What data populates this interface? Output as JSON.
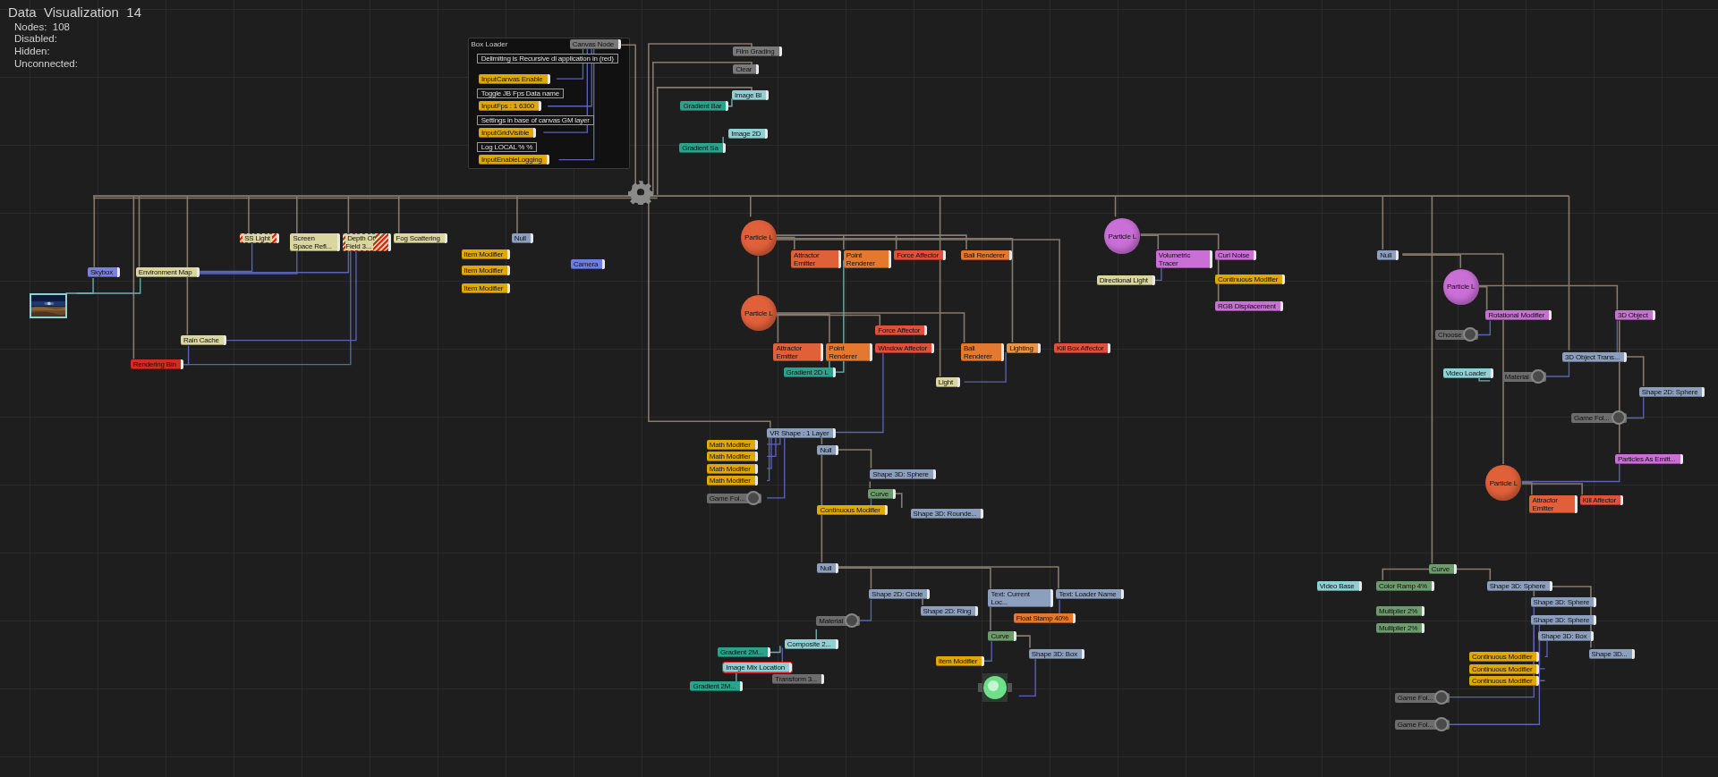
{
  "header": {
    "title": "Data  Visualization  14",
    "stats": [
      "Nodes:  108",
      "Disabled:",
      "Hidden:",
      "Unconnected:"
    ]
  },
  "group": {
    "title": "Box Loader"
  },
  "nodes": [
    {
      "kind": "bar",
      "label": "Canvas Node",
      "color": "#7a7a7a"
    },
    {
      "kind": "comment",
      "label": "Delimiting is Recursive dl application in (red)"
    },
    {
      "kind": "bar",
      "label": "InputCanvas Enable",
      "color": "#e0a800"
    },
    {
      "kind": "comment",
      "label": "Toggle JB Fps Data name"
    },
    {
      "kind": "bar",
      "label": "InputFps : 1 6300",
      "color": "#e0a800"
    },
    {
      "kind": "comment",
      "label": "Settings in base of canvas GM layer"
    },
    {
      "kind": "bar",
      "label": "InputGridVisible",
      "color": "#e0a800"
    },
    {
      "kind": "comment",
      "label": "Log LOCAL % %"
    },
    {
      "kind": "bar",
      "label": "InputEnableLogging",
      "color": "#e0a800"
    },
    {
      "kind": "bar",
      "label": "Film Grading",
      "color": "#7a7a7a"
    },
    {
      "kind": "bar",
      "label": "Clear",
      "color": "#7a7a7a"
    },
    {
      "kind": "bar",
      "label": "Gradient Bar",
      "color": "#2aa38a"
    },
    {
      "kind": "bar",
      "label": "Image Bl",
      "color": "#8fd0d4"
    },
    {
      "kind": "bar",
      "label": "Gradient Sa",
      "color": "#2aa38a"
    },
    {
      "kind": "bar",
      "label": "Image 2D",
      "color": "#8fd0d4"
    },
    {
      "kind": "picture",
      "color": "#8fd0d4"
    },
    {
      "kind": "bar",
      "label": "Skybox",
      "color": "#7b7fe0"
    },
    {
      "kind": "bar",
      "label": "Environment Map",
      "color": "#d9d6a0"
    },
    {
      "kind": "hatched",
      "label": "SS Light",
      "color": "#d9d6a0"
    },
    {
      "kind": "bar",
      "label": "Screen Space Refl...",
      "color": "#d9d6a0"
    },
    {
      "kind": "hatched",
      "label": "Depth Of Field 3...",
      "color": "#d9d6a0"
    },
    {
      "kind": "bar",
      "label": "Fog Scattering",
      "color": "#d9d6a0"
    },
    {
      "kind": "bar",
      "label": "Rain Cache",
      "color": "#d9d6a0"
    },
    {
      "kind": "bar",
      "label": "Rendering Bin",
      "color": "#d62b1f"
    },
    {
      "kind": "bar",
      "label": "Item Modifier",
      "color": "#e0a800"
    },
    {
      "kind": "bar",
      "label": "Item Modifier",
      "color": "#e0a800"
    },
    {
      "kind": "bar",
      "label": "Item Modifier",
      "color": "#e0a800"
    },
    {
      "kind": "bar",
      "label": "Null",
      "color": "#8c9fbe"
    },
    {
      "kind": "bar",
      "label": "Camera",
      "color": "#6c7fe0"
    },
    {
      "kind": "sphere",
      "label": "Particle L",
      "color": "#e0603a"
    },
    {
      "kind": "sphere",
      "label": "Particle L",
      "color": "#e0603a"
    },
    {
      "kind": "bar",
      "label": "Attractor Emitter",
      "color": "#e0603a"
    },
    {
      "kind": "bar",
      "label": "Point Renderer",
      "color": "#e4782e"
    },
    {
      "kind": "bar",
      "label": "Force Affector",
      "color": "#e0503a"
    },
    {
      "kind": "bar",
      "label": "Ball Renderer",
      "color": "#e4782e"
    },
    {
      "kind": "bar",
      "label": "Attractor Emitter",
      "color": "#e0603a"
    },
    {
      "kind": "bar",
      "label": "Point Renderer",
      "color": "#e4782e"
    },
    {
      "kind": "bar",
      "label": "Force Affector",
      "color": "#e0503a"
    },
    {
      "kind": "bar",
      "label": "Window Affector",
      "color": "#e0503a"
    },
    {
      "kind": "bar",
      "label": "Ball Renderer",
      "color": "#e4782e"
    },
    {
      "kind": "bar",
      "label": "Lighting",
      "color": "#e8954a"
    },
    {
      "kind": "bar",
      "label": "Kill Box Affector",
      "color": "#e0503a"
    },
    {
      "kind": "bar",
      "label": "Gradient 2D L",
      "color": "#2aa38a"
    },
    {
      "kind": "bar",
      "label": "Light",
      "color": "#d9d6a0"
    },
    {
      "kind": "sphere",
      "label": "Particle L",
      "color": "#c96fd6"
    },
    {
      "kind": "bar",
      "label": "Volumetric Tracer",
      "color": "#c96fd6"
    },
    {
      "kind": "bar",
      "label": "Curl Noise",
      "color": "#c96fd6"
    },
    {
      "kind": "bar",
      "label": "Continuous Modifier",
      "color": "#e0a800"
    },
    {
      "kind": "bar",
      "label": "RGB Displacement",
      "color": "#c96fd6"
    },
    {
      "kind": "bar",
      "label": "Directional Light",
      "color": "#d9d6a0"
    },
    {
      "kind": "bar",
      "label": "Null",
      "color": "#8c9fbe"
    },
    {
      "kind": "sphere",
      "label": "Particle L",
      "color": "#c96fd6"
    },
    {
      "kind": "bar",
      "label": "Rotational Modifier",
      "color": "#c96fd6"
    },
    {
      "kind": "bar",
      "label": "3D Object",
      "color": "#c96fd6"
    },
    {
      "kind": "dial",
      "label": "Choose",
      "color": "#6c6c6c"
    },
    {
      "kind": "bar",
      "label": "3D Object Trans...",
      "color": "#8c9fbe"
    },
    {
      "kind": "bar",
      "label": "Video Loader",
      "color": "#8fd0d4"
    },
    {
      "kind": "dial",
      "label": "Material",
      "color": "#6c6c6c"
    },
    {
      "kind": "bar",
      "label": "Shape 2D: Sphere",
      "color": "#8c9fbe"
    },
    {
      "kind": "dial",
      "label": "Game Fol...",
      "color": "#6c6c6c"
    },
    {
      "kind": "bar",
      "label": "Particles As Emitt...",
      "color": "#c96fd6"
    },
    {
      "kind": "sphere",
      "label": "Particle L",
      "color": "#e0603a"
    },
    {
      "kind": "bar",
      "label": "Attractor Emitter",
      "color": "#e0603a"
    },
    {
      "kind": "bar",
      "label": "Kill Affector",
      "color": "#e0503a"
    },
    {
      "kind": "bar",
      "label": "VR Shape : 1 Layer",
      "color": "#8c9fbe"
    },
    {
      "kind": "bar",
      "label": "Math Modifier",
      "color": "#e0a800"
    },
    {
      "kind": "bar",
      "label": "Math Modifier",
      "color": "#e0a800"
    },
    {
      "kind": "bar",
      "label": "Math Modifier",
      "color": "#e0a800"
    },
    {
      "kind": "bar",
      "label": "Math Modifier",
      "color": "#e0a800"
    },
    {
      "kind": "dial",
      "label": "Game Fol...",
      "color": "#6c6c6c"
    },
    {
      "kind": "bar",
      "label": "Null",
      "color": "#8c9fbe"
    },
    {
      "kind": "bar",
      "label": "Shape 3D: Sphere",
      "color": "#8c9fbe"
    },
    {
      "kind": "bar",
      "label": "Curve",
      "color": "#6c9b6c"
    },
    {
      "kind": "bar",
      "label": "Continuous Modifier",
      "color": "#e0a800"
    },
    {
      "kind": "bar",
      "label": "Shape 3D: Rounde...",
      "color": "#8c9fbe"
    },
    {
      "kind": "bar",
      "label": "Null",
      "color": "#8c9fbe"
    },
    {
      "kind": "bar",
      "label": "Shape 2D: Circle",
      "color": "#8c9fbe"
    },
    {
      "kind": "bar",
      "label": "Shape 2D: Ring",
      "color": "#8c9fbe"
    },
    {
      "kind": "bar",
      "label": "Text: Current Loc...",
      "color": "#8c9fbe"
    },
    {
      "kind": "bar",
      "label": "Text: Loader Name",
      "color": "#8c9fbe"
    },
    {
      "kind": "bar",
      "label": "Float Stamp 40%",
      "color": "#e4782e"
    },
    {
      "kind": "bar",
      "label": "Curve",
      "color": "#6c9b6c"
    },
    {
      "kind": "bar",
      "label": "Shape 3D: Box",
      "color": "#8c9fbe"
    },
    {
      "kind": "bar",
      "label": "Item Modifier",
      "color": "#e0a800"
    },
    {
      "kind": "orb",
      "color": "#6ee08a"
    },
    {
      "kind": "dial",
      "label": "Material",
      "color": "#6c6c6c"
    },
    {
      "kind": "bar",
      "label": "Composite 2...",
      "color": "#8fd0d4"
    },
    {
      "kind": "bar",
      "label": "Gradient 2M...",
      "color": "#2aa38a"
    },
    {
      "kind": "outlined",
      "label": "Image Mix Location",
      "color": "#8fd0d4"
    },
    {
      "kind": "bar",
      "label": "Transform 3...",
      "color": "#6c6c6c"
    },
    {
      "kind": "bar",
      "label": "Gradient 2M...",
      "color": "#2aa38a"
    },
    {
      "kind": "bar",
      "label": "Curve",
      "color": "#6c9b6c"
    },
    {
      "kind": "bar",
      "label": "Video Base",
      "color": "#8fd0d4"
    },
    {
      "kind": "bar",
      "label": "Color Ramp 4%",
      "color": "#6c9b6c"
    },
    {
      "kind": "bar",
      "label": "Multiplier 2%",
      "color": "#6c9b6c"
    },
    {
      "kind": "bar",
      "label": "Multiplier 2%",
      "color": "#6c9b6c"
    },
    {
      "kind": "bar",
      "label": "Shape 3D: Sphere",
      "color": "#8c9fbe"
    },
    {
      "kind": "bar",
      "label": "Shape 3D: Sphere",
      "color": "#8c9fbe"
    },
    {
      "kind": "bar",
      "label": "Shape 3D: Sphere",
      "color": "#8c9fbe"
    },
    {
      "kind": "bar",
      "label": "Shape 3D: Box",
      "color": "#8c9fbe"
    },
    {
      "kind": "bar",
      "label": "Continuous Modifier",
      "color": "#e0a800"
    },
    {
      "kind": "bar",
      "label": "Shape 3D...",
      "color": "#8c9fbe"
    },
    {
      "kind": "bar",
      "label": "Continuous Modifier",
      "color": "#e0a800"
    },
    {
      "kind": "bar",
      "label": "Continuous Modifier",
      "color": "#e0a800"
    },
    {
      "kind": "dial",
      "label": "Game Fol...",
      "color": "#6c6c6c"
    },
    {
      "kind": "dial",
      "label": "Game Fol...",
      "color": "#6c6c6c"
    }
  ]
}
